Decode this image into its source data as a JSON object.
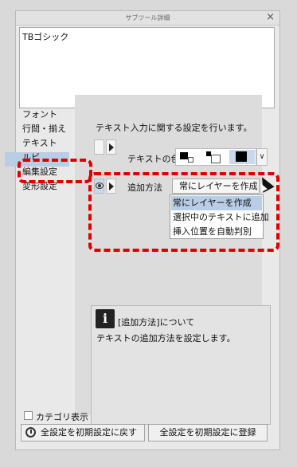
{
  "panel": {
    "title": "サブツール詳細",
    "close": "×"
  },
  "preview": {
    "text": "TBゴシック"
  },
  "categories": [
    {
      "label": "フォント"
    },
    {
      "label": "行間・揃え"
    },
    {
      "label": "テキスト"
    },
    {
      "label": "ルビ"
    },
    {
      "label": "編集設定",
      "selected": true
    },
    {
      "label": "変形設定"
    }
  ],
  "settings": {
    "description": "テキスト入力に関する設定を行います。",
    "text_color_label": "テキストの色",
    "method_label": "追加方法",
    "method_value": "常にレイヤーを作成",
    "dropdown_arrow": "∨",
    "method_options": [
      {
        "label": "常にレイヤーを作成",
        "selected": true
      },
      {
        "label": "選択中のテキストに追加"
      },
      {
        "label": "挿入位置を自動判別"
      }
    ]
  },
  "info": {
    "icon": "i",
    "title": "[追加方法]について",
    "body": "テキストの追加方法を設定します。"
  },
  "footer": {
    "category_display": "カテゴリ表示",
    "reset_all": "全設定を初期設定に戻す",
    "register_all": "全設定を初期設定に登録"
  },
  "colors": {
    "highlight": "#b9cde6",
    "annotation_red": "#e00000"
  },
  "icons": [
    "close-icon",
    "eye-icon",
    "play-icon",
    "info-icon",
    "reset-icon",
    "cursor-icon",
    "chevron-down-icon"
  ]
}
